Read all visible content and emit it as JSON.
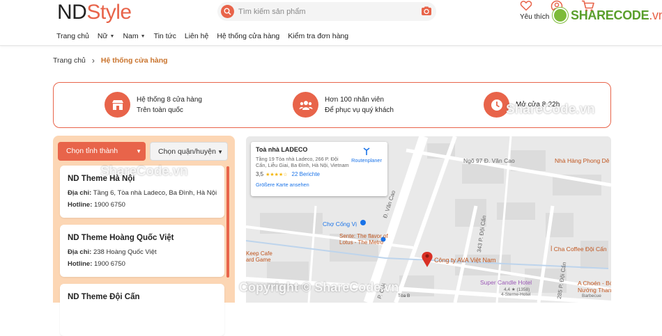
{
  "header": {
    "logo_part1": "ND",
    "logo_part2": "Style",
    "search_placeholder": "Tìm kiếm sản phẩm",
    "wishlist_label": "Yêu thích",
    "nav": [
      {
        "label": "Trang chủ",
        "has_dropdown": false
      },
      {
        "label": "Nữ",
        "has_dropdown": true
      },
      {
        "label": "Nam",
        "has_dropdown": true
      },
      {
        "label": "Tin tức",
        "has_dropdown": false
      },
      {
        "label": "Liên hệ",
        "has_dropdown": false
      },
      {
        "label": "Hệ thống cửa hàng",
        "has_dropdown": false
      },
      {
        "label": "Kiểm tra đơn hàng",
        "has_dropdown": false
      }
    ]
  },
  "watermarks": {
    "brand": "SHARECODE",
    "brand_suffix": ".vn",
    "left": "ShareCode.vn",
    "right": "ShareCode.vn",
    "bottom": "Copyright © ShareCode.vn"
  },
  "breadcrumb": {
    "home": "Trang chủ",
    "current": "Hệ thống cửa hàng"
  },
  "features": [
    {
      "icon": "store-icon",
      "line1": "Hệ thống 8 cửa hàng",
      "line2": "Trên toàn quốc"
    },
    {
      "icon": "people-icon",
      "line1": "Hơn 100 nhân viên",
      "line2": "Để phục vụ quý khách"
    },
    {
      "icon": "clock-icon",
      "line1": "Mở cửa 8-22h",
      "line2": ""
    }
  ],
  "filters": {
    "province": "Chọn tỉnh thành",
    "district": "Chọn quận/huyện"
  },
  "stores": [
    {
      "name": "ND Theme Hà Nội",
      "address_label": "Địa chỉ:",
      "address": "Tầng 6, Tòa nhà Ladeco, Ba Đình, Hà Nội",
      "hotline_label": "Hotline:",
      "hotline": "1900 6750"
    },
    {
      "name": "ND Theme Hoàng Quốc Việt",
      "address_label": "Địa chỉ:",
      "address": "238 Hoàng Quốc Việt",
      "hotline_label": "Hotline:",
      "hotline": "1900 6750"
    },
    {
      "name": "ND Theme Đội Cấn",
      "address_label": "",
      "address": "",
      "hotline_label": "",
      "hotline": ""
    }
  ],
  "map": {
    "place_title": "Toà nhà LADECO",
    "place_address": "Tầng 19 Tòa nhà Ladeco, 266 P. Đội Cấn, Liễu Giai, Ba Đình, Hà Nội, Vietnam",
    "rating": "3,5",
    "reviews": "22 Berichte",
    "larger_map": "Größere Karte ansehen",
    "route": "Routenplaner",
    "marker_label": "Công ty AVA Việt Nam",
    "labels": [
      {
        "text": "Ngõ 97 Đ. Văn Cao",
        "color": "#666666"
      },
      {
        "text": "Nhà Hàng Phong Dê",
        "color": "#c0551e"
      },
      {
        "text": "Chợ Cống Vị",
        "color": "#1a73e8"
      },
      {
        "text": "Sente: The flavor of",
        "color": "#c0551e"
      },
      {
        "text": "Lotus - The Metro",
        "color": "#c0551e"
      },
      {
        "text": "Keep Cafe",
        "color": "#c0551e"
      },
      {
        "text": "ard Game",
        "color": "#c0551e"
      },
      {
        "text": "Ỉ Cha Coffee Đội Cấn",
        "color": "#c0551e"
      },
      {
        "text": "Super Candle Hotel",
        "color": "#9b59b6"
      },
      {
        "text": "4,4 ★ (1358)",
        "color": "#666666"
      },
      {
        "text": "4-Sterne-Hotel",
        "color": "#666666"
      },
      {
        "text": "A Choén - Bò",
        "color": "#c0551e"
      },
      {
        "text": "Nướng Than",
        "color": "#c0551e"
      },
      {
        "text": "Barbecue",
        "color": "#666666"
      },
      {
        "text": "Đ. Văn Cao",
        "color": "#666666"
      },
      {
        "text": "P. Giải",
        "color": "#666666"
      },
      {
        "text": "343 P. Đội Cấn",
        "color": "#666666"
      },
      {
        "text": "285 P. Đội Cấn",
        "color": "#666666"
      },
      {
        "text": "Tòa B",
        "color": "#444444"
      }
    ]
  },
  "colors": {
    "accent": "#e8644a",
    "accent_light": "#fcd6b4",
    "breadcrumb_current": "#c9732c"
  }
}
